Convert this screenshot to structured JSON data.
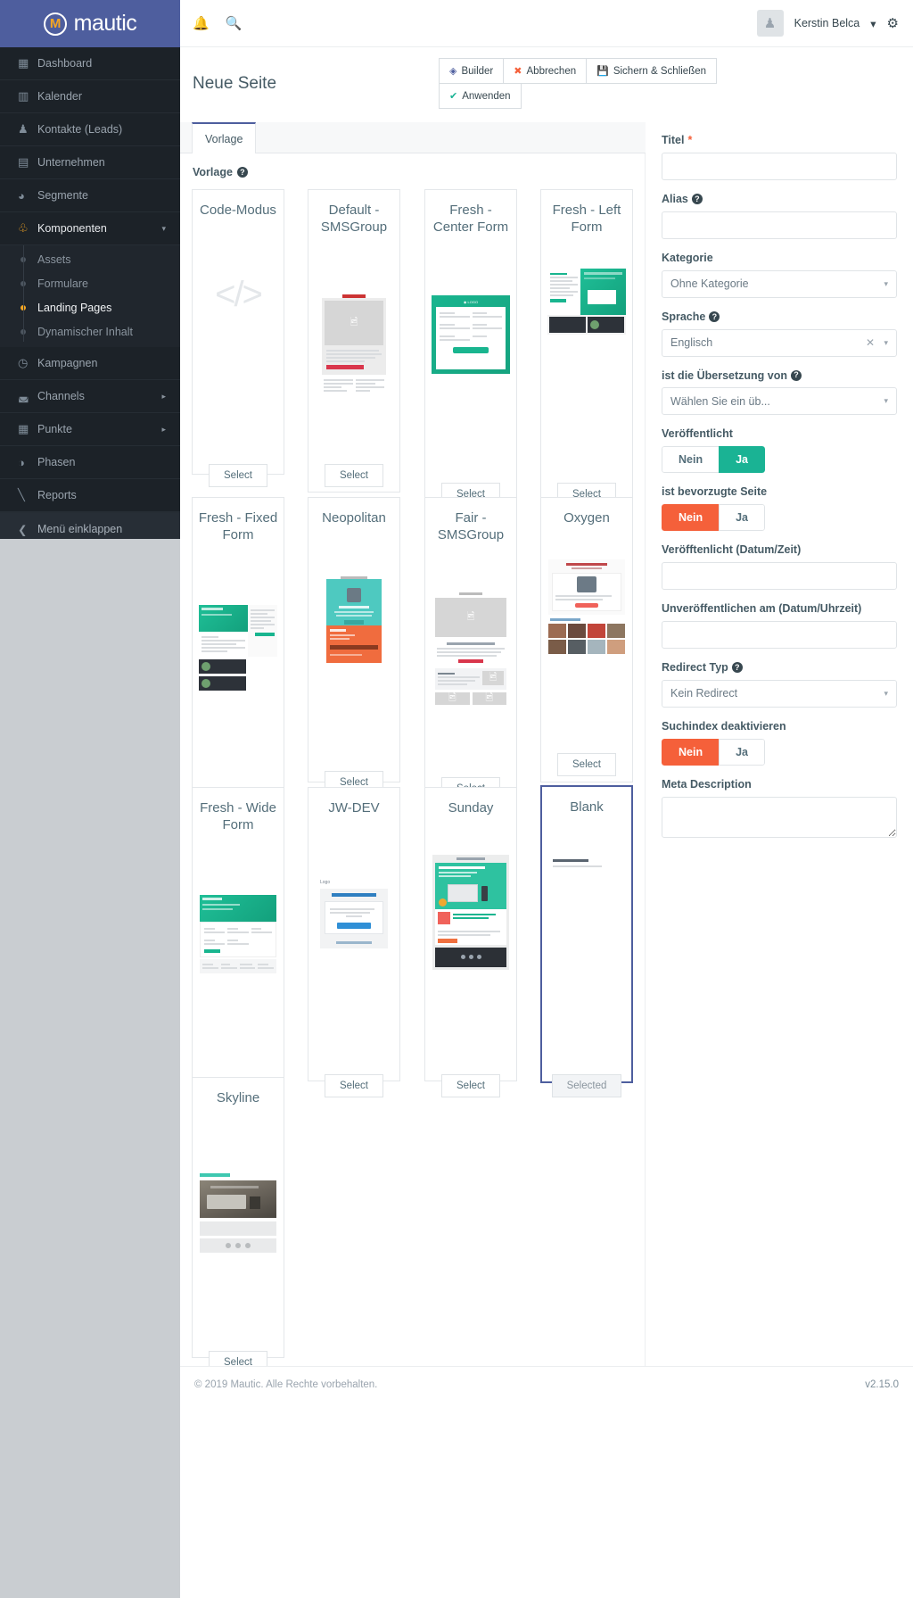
{
  "brand": {
    "name": "mautic",
    "logo_letter": "M"
  },
  "topbar": {
    "bell_icon": "bell-icon",
    "search_icon": "search-icon",
    "user_name": "Kerstin Belca",
    "gear_icon": "gear-icon",
    "avatar_icon": "user-avatar-icon",
    "caret": "▾"
  },
  "sidebar": {
    "items": [
      {
        "label": "Dashboard",
        "icon": "grid-icon",
        "glyph": "▦"
      },
      {
        "label": "Kalender",
        "icon": "calendar-icon",
        "glyph": "▤"
      },
      {
        "label": "Kontakte (Leads)",
        "icon": "person-icon",
        "glyph": "👤"
      },
      {
        "label": "Unternehmen",
        "icon": "building-icon",
        "glyph": "🏢"
      },
      {
        "label": "Segmente",
        "icon": "pie-chart-icon",
        "glyph": "◕"
      },
      {
        "label": "Komponenten",
        "icon": "puzzle-icon",
        "glyph": "🧩",
        "expanded": true,
        "caret": "▾"
      },
      {
        "label": "Kampagnen",
        "icon": "clock-icon",
        "glyph": "◴"
      },
      {
        "label": "Channels",
        "icon": "rss-icon",
        "glyph": "≫",
        "caret": "▸"
      },
      {
        "label": "Punkte",
        "icon": "table-icon",
        "glyph": "▦",
        "caret": "▸"
      },
      {
        "label": "Phasen",
        "icon": "gauge-icon",
        "glyph": "◑"
      },
      {
        "label": "Reports",
        "icon": "chart-icon",
        "glyph": "📈"
      }
    ],
    "subitems": [
      {
        "label": "Assets",
        "active": false
      },
      {
        "label": "Formulare",
        "active": false
      },
      {
        "label": "Landing Pages",
        "active": true
      },
      {
        "label": "Dynamischer Inhalt",
        "active": false
      }
    ],
    "collapse": {
      "label": "Menü einklappen",
      "icon": "chevron-left-icon",
      "glyph": "❮"
    }
  },
  "page": {
    "title": "Neue Seite",
    "buttons": [
      {
        "label": "Builder",
        "icon": "cube-icon",
        "glyph": "◈"
      },
      {
        "label": "Abbrechen",
        "icon": "close-icon",
        "glyph": "✖"
      },
      {
        "label": "Sichern & Schließen",
        "icon": "save-icon",
        "glyph": "▤"
      },
      {
        "label": "Anwenden",
        "icon": "check-icon",
        "glyph": "✔"
      }
    ],
    "tab": {
      "label": "Vorlage"
    },
    "section_label": "Vorlage",
    "help_glyph": "?"
  },
  "templates": {
    "select_label": "Select",
    "selected_label": "Selected",
    "items": [
      {
        "name": "Code-Modus",
        "thumb": "code",
        "selected": false
      },
      {
        "name": "Default - SMSGroup",
        "thumb": "default-sms",
        "selected": false
      },
      {
        "name": "Fresh - Center Form",
        "thumb": "fresh-center",
        "selected": false
      },
      {
        "name": "Fresh - Left Form",
        "thumb": "fresh-left",
        "selected": false
      },
      {
        "name": "Fresh - Fixed Form",
        "thumb": "fresh-fixed",
        "selected": false
      },
      {
        "name": "Neopolitan",
        "thumb": "neopolitan",
        "selected": false
      },
      {
        "name": "Fair - SMSGroup",
        "thumb": "fair-sms",
        "selected": false
      },
      {
        "name": "Oxygen",
        "thumb": "oxygen",
        "selected": false
      },
      {
        "name": "Fresh - Wide Form",
        "thumb": "fresh-wide",
        "selected": false
      },
      {
        "name": "JW-DEV",
        "thumb": "jwdev",
        "selected": false
      },
      {
        "name": "Sunday",
        "thumb": "sunday",
        "selected": false
      },
      {
        "name": "Blank",
        "thumb": "blank",
        "selected": true
      },
      {
        "name": "Skyline",
        "thumb": "skyline",
        "selected": false
      }
    ]
  },
  "form": {
    "title": {
      "label": "Titel",
      "required_mark": "*",
      "value": "",
      "placeholder": ""
    },
    "alias": {
      "label": "Alias",
      "help": "?",
      "value": "",
      "placeholder": ""
    },
    "kategorie": {
      "label": "Kategorie",
      "value": "Ohne Kategorie",
      "arrow": "▾"
    },
    "sprache": {
      "label": "Sprache",
      "help": "?",
      "value": "Englisch",
      "clear": "✕",
      "arrow": "▾"
    },
    "uebersetzung": {
      "label": "ist die Übersetzung von",
      "help": "?",
      "value": "Wählen Sie ein üb...",
      "arrow": "▾"
    },
    "veroeffentlicht": {
      "label": "Veröffentlicht",
      "off_label": "Nein",
      "on_label": "Ja",
      "state": "Ja"
    },
    "bevorzugte": {
      "label": "ist bevorzugte Seite",
      "off_label": "Nein",
      "on_label": "Ja",
      "state": "Nein"
    },
    "publish_date": {
      "label": "Veröfftenlicht (Datum/Zeit)",
      "value": "",
      "placeholder": ""
    },
    "unpublish_date": {
      "label": "Unveröffentlichen am (Datum/Uhrzeit)",
      "value": "",
      "placeholder": ""
    },
    "redirect": {
      "label": "Redirect Typ",
      "help": "?",
      "value": "Kein Redirect",
      "arrow": "▾"
    },
    "suchindex": {
      "label": "Suchindex deaktivieren",
      "off_label": "Nein",
      "on_label": "Ja",
      "state": "Nein"
    },
    "meta": {
      "label": "Meta Description",
      "value": "",
      "placeholder": ""
    }
  },
  "footer": {
    "copyright": "© 2019 Mautic. Alle Rechte vorbehalten.",
    "version": "v2.15.0"
  },
  "colors": {
    "brand_blue": "#4e5e9e",
    "sidebar_dark": "#1c2228",
    "accent_orange": "#f5a623",
    "success_green": "#1ab394",
    "danger_red": "#f5603a"
  }
}
